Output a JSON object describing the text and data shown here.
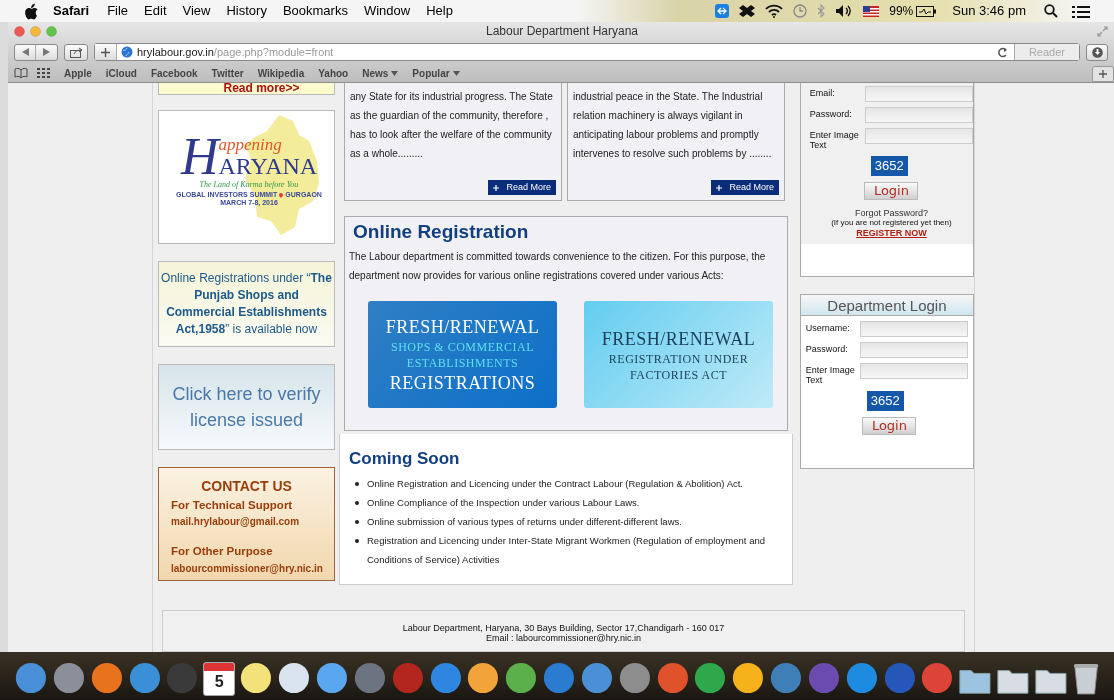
{
  "menu_bar": {
    "app": "Safari",
    "menus": [
      "File",
      "Edit",
      "View",
      "History",
      "Bookmarks",
      "Window",
      "Help"
    ],
    "battery": "99%",
    "clock": "Sun 3:46 pm"
  },
  "window": {
    "title": "Labour Department Haryana",
    "url_host": "hrylabour.gov.in",
    "url_path": "/page.php?module=front",
    "reader": "Reader",
    "bookmarks": [
      {
        "label": "Apple",
        "menu": false
      },
      {
        "label": "iCloud",
        "menu": false
      },
      {
        "label": "Facebook",
        "menu": false
      },
      {
        "label": "Twitter",
        "menu": false
      },
      {
        "label": "Wikipedia",
        "menu": false
      },
      {
        "label": "Yahoo",
        "menu": false
      },
      {
        "label": "News",
        "menu": true
      },
      {
        "label": "Popular",
        "menu": true
      }
    ]
  },
  "left_column": {
    "read_more": "Read more>>",
    "banner": {
      "logo_top": "appening",
      "logo_initial": "H",
      "logo_rest": "ARYANA",
      "tagline": "The Land of Karma before You",
      "event_left": "GLOBAL INVESTORS SUMMIT",
      "event_right": "GURGAON",
      "dates": "MARCH 7-8, 2016"
    },
    "notice": "Online Registrations under “**The Punjab Shops and Commercial Establishments Act,1958**” is available now",
    "verify": "Click here to verify license issued",
    "contact": {
      "title": "CONTACT US",
      "groups": [
        {
          "heading": "For Technical Support",
          "email": "mail.hrylabour@gmail.com"
        },
        {
          "heading": "For Other Purpose",
          "email": "labourcommissioner@hry.nic.in"
        }
      ]
    }
  },
  "cards": [
    {
      "text": "any State for its industrial progress. The State as the guardian of the community, therefore , has to look after the welfare of the community as a whole.........",
      "button": "Read More"
    },
    {
      "text": "industrial peace in the State. The Industrial relation machinery is always vigilant in anticipating labour problems and promptly intervenes to resolve such problems by ........",
      "button": "Read More"
    }
  ],
  "online_registration": {
    "heading": "Online Registration",
    "text": "The Labour department is committed towards convenience to the citizen. For this purpose, the department now provides for various online registrations covered under various Acts:",
    "tiles": [
      {
        "kind": "dark",
        "lines": [
          {
            "kind": "title",
            "text": "FRESH/RENEWAL"
          },
          {
            "kind": "sub",
            "text": "SHOPS & COMMERCIAL"
          },
          {
            "kind": "sub",
            "text": "ESTABLISHMENTS"
          },
          {
            "kind": "title",
            "text": "REGISTRATIONS"
          }
        ]
      },
      {
        "kind": "light",
        "lines": [
          {
            "kind": "title",
            "text": "FRESH/RENEWAL"
          },
          {
            "kind": "sub",
            "text": "REGISTRATION UNDER"
          },
          {
            "kind": "sub",
            "text": "FACTORIES ACT"
          }
        ]
      }
    ]
  },
  "coming_soon": {
    "heading": "Coming Soon",
    "items": [
      "Online Registration and Licencing under the Contract Labour (Regulation & Abolition) Act.",
      "Online Compliance of the Inspection under various Labour Laws.",
      "Online submission of various types of returns under different-different laws.",
      "Registration and Licencing under Inter-State Migrant Workmen (Regulation of employment and Conditions of Service) Activities"
    ]
  },
  "user_login": {
    "fields": [
      {
        "label": "Email:"
      },
      {
        "label": "Password:"
      },
      {
        "label": "Enter Image Text"
      }
    ],
    "captcha": "3652",
    "button": "Login",
    "forgot": "Forgot Password?",
    "note": "(If you are not registered yet then)",
    "register": "REGISTER NOW"
  },
  "department_login": {
    "title": "Department Login",
    "fields": [
      {
        "label": "Username:"
      },
      {
        "label": "Password:"
      },
      {
        "label": "Enter Image Text"
      }
    ],
    "captcha": "3652",
    "button": "Login"
  },
  "footer": {
    "address": "Labour Department, Haryana, 30 Bays Building, Sector 17,Chandigarh - 160 017",
    "email": "Email : labourcommissioner@hry.nic.in"
  },
  "dock": [
    {
      "kind": "app",
      "color": "#4a90d9"
    },
    {
      "kind": "app",
      "color": "#8a8f99"
    },
    {
      "kind": "app",
      "color": "#e8731c"
    },
    {
      "kind": "app",
      "color": "#3b8fd6"
    },
    {
      "kind": "app",
      "color": "#3a3a3a"
    },
    {
      "kind": "calendar",
      "color": "#ffffff",
      "text": "5"
    },
    {
      "kind": "app",
      "color": "#f3e27a"
    },
    {
      "kind": "app",
      "color": "#d9e4ee"
    },
    {
      "kind": "app",
      "color": "#5aa7f0"
    },
    {
      "kind": "app",
      "color": "#6b7480"
    },
    {
      "kind": "app",
      "color": "#b3261e"
    },
    {
      "kind": "app",
      "color": "#2f86e0"
    },
    {
      "kind": "app",
      "color": "#f2a33a"
    },
    {
      "kind": "app",
      "color": "#5bb04b"
    },
    {
      "kind": "app",
      "color": "#2b7bd1"
    },
    {
      "kind": "app",
      "color": "#4b8fd6"
    },
    {
      "kind": "app",
      "color": "#8d8d8d"
    },
    {
      "kind": "app",
      "color": "#e0522b"
    },
    {
      "kind": "app",
      "color": "#2ea84a"
    },
    {
      "kind": "app",
      "color": "#f5b21a"
    },
    {
      "kind": "app",
      "color": "#3f7fb8"
    },
    {
      "kind": "app",
      "color": "#6c4bb0"
    },
    {
      "kind": "app",
      "color": "#1d8ce0"
    },
    {
      "kind": "app",
      "color": "#2457b8"
    },
    {
      "kind": "app",
      "color": "#db4437"
    },
    {
      "kind": "folder",
      "color": "#9cc3e0"
    },
    {
      "kind": "folder",
      "color": "#d8dde3"
    },
    {
      "kind": "folder",
      "color": "#d8dde3"
    },
    {
      "kind": "trash",
      "color": "#c9ced4"
    }
  ]
}
